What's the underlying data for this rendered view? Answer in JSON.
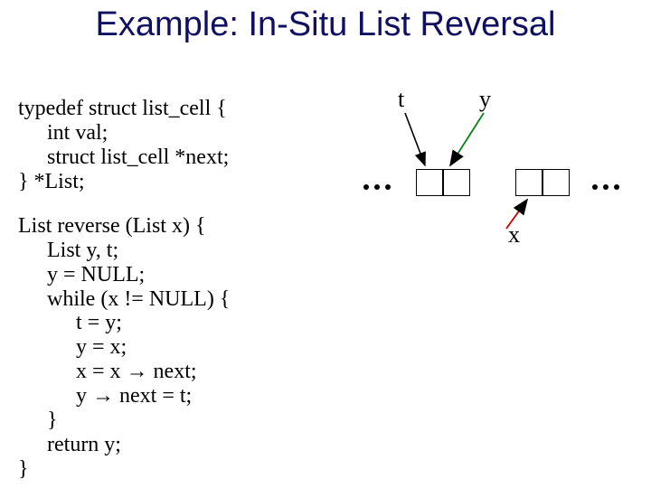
{
  "title": "Example: In-Situ List Reversal",
  "typedef": {
    "l1": "typedef struct list_cell {",
    "l2": "int val;",
    "l3": "struct list_cell *next;",
    "l4": "} *List;"
  },
  "reverse": {
    "l1": "List reverse (List x) {",
    "l2": "List y, t;",
    "l3": "y = NULL;",
    "l4": "while (x != NULL) {",
    "l5": "t = y;",
    "l6": "y = x;",
    "l7a": "x = x ",
    "l7b": " next;",
    "l8a": "y ",
    "l8b": " next = t;",
    "l9": "}",
    "l10": "return y;",
    "l11": "}"
  },
  "arrow_glyph": "→",
  "diagram": {
    "t_label": "t",
    "y_label": "y",
    "x_label": "x"
  }
}
